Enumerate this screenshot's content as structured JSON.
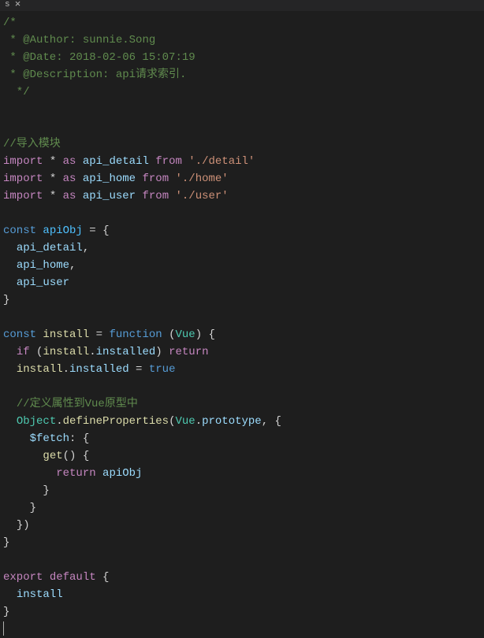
{
  "tab": {
    "label": "s",
    "closeGlyph": "×"
  },
  "code": {
    "line1": "/*",
    "line2_prefix": " * @Author: ",
    "line2_author": "sunnie.Song",
    "line3_prefix": " * @Date: ",
    "line3_date": "2018-02-06 15:07:19",
    "line4_prefix": " * @Description: ",
    "line4_desc": "api请求索引.",
    "line5": "  */",
    "line7": "//导入模块",
    "import_kw": "import",
    "star": "*",
    "as_kw": "as",
    "from_kw": "from",
    "api_detail": "api_detail",
    "api_home": "api_home",
    "api_user": "api_user",
    "path_detail": "'./detail'",
    "path_home": "'./home'",
    "path_user": "'./user'",
    "const_kw": "const",
    "apiObj": "apiObj",
    "eq": " = ",
    "lbrace": "{",
    "rbrace": "}",
    "comma": ",",
    "install": "install",
    "function_kw": "function",
    "Vue": "Vue",
    "lparen": "(",
    "rparen": ")",
    "if_kw": "if",
    "install_installed_l": "install",
    "install_installed_r": "installed",
    "dot": ".",
    "return_kw": "return",
    "true_kw": "true",
    "comment_vue": "//定义属性到Vue原型中",
    "Object": "Object",
    "defineProperties": "defineProperties",
    "prototype": "prototype",
    "fetch_key": "$fetch",
    "colon": ":",
    "get": "get",
    "apiObj2": "apiObj",
    "export_kw": "export",
    "default_kw": "default"
  }
}
